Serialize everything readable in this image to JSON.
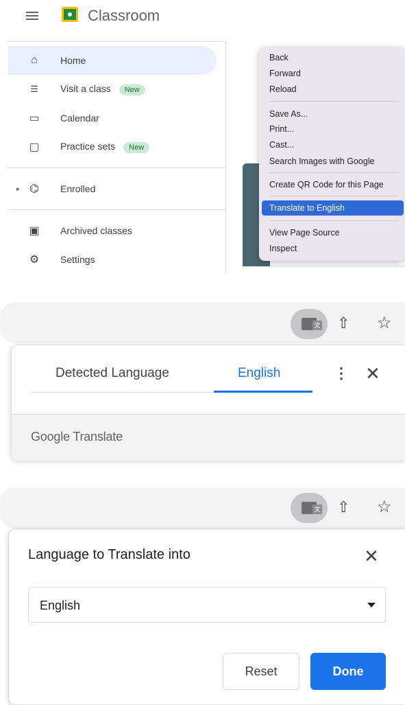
{
  "classroom": {
    "app_title": "Classroom",
    "nav": {
      "home": "Home",
      "visit": "Visit a class",
      "visit_badge": "New",
      "calendar": "Calendar",
      "practice": "Practice sets",
      "practice_badge": "New",
      "enrolled": "Enrolled",
      "archived": "Archived classes",
      "settings": "Settings"
    }
  },
  "context_menu": {
    "items": [
      "Back",
      "Forward",
      "Reload",
      "Save As...",
      "Print...",
      "Cast...",
      "Search Images with Google",
      "Create QR Code for this Page",
      "Translate to English",
      "View Page Source",
      "Inspect"
    ]
  },
  "translate_bubble": {
    "tab_detected": "Detected Language",
    "tab_english": "English",
    "footer": "Google Translate"
  },
  "language_dialog": {
    "title": "Language to Translate into",
    "selected_language": "English",
    "reset_label": "Reset",
    "done_label": "Done"
  },
  "colors": {
    "accent": "#1a73e8",
    "menu_highlight": "#2f6bd6",
    "badge_bg": "#ceead6"
  },
  "icons": [
    "hamburger-icon",
    "classroom-logo-icon",
    "home-icon",
    "visit-class-icon",
    "calendar-icon",
    "practice-sets-icon",
    "enrolled-icon",
    "archive-icon",
    "settings-icon",
    "translate-icon",
    "share-icon",
    "star-icon",
    "more-vert-icon",
    "close-icon",
    "dropdown-caret-icon"
  ]
}
